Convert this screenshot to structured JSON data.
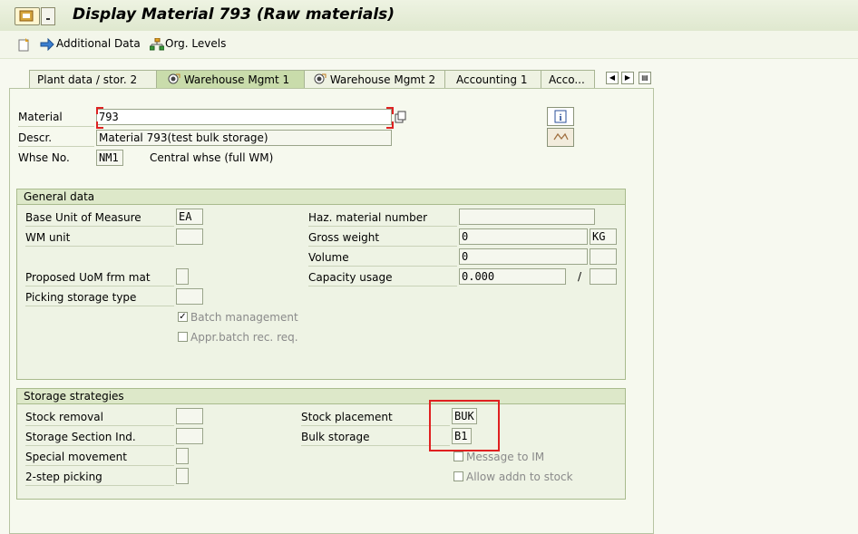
{
  "window": {
    "title": "Display Material 793 (Raw materials)"
  },
  "toolbar": {
    "additional_data": "Additional Data",
    "org_levels": "Org. Levels"
  },
  "tabs": [
    "Plant data / stor. 2",
    "Warehouse Mgmt 1",
    "Warehouse Mgmt 2",
    "Accounting 1",
    "Acco..."
  ],
  "header": {
    "material_label": "Material",
    "material_value": "793",
    "descr_label": "Descr.",
    "descr_value": "Material 793(test bulk storage)",
    "whse_label": "Whse No.",
    "whse_value": "NM1",
    "whse_text": "Central whse (full WM)"
  },
  "general": {
    "title": "General data",
    "base_uom_label": "Base Unit of Measure",
    "base_uom_value": "EA",
    "wm_unit_label": "WM unit",
    "wm_unit_value": "",
    "proposed_uom_label": "Proposed UoM frm mat",
    "proposed_uom_value": "",
    "picking_label": "Picking storage type",
    "picking_value": "",
    "batch_label": "Batch management",
    "batch_checked": true,
    "appr_label": "Appr.batch rec. req.",
    "appr_checked": false,
    "haz_label": "Haz. material number",
    "haz_value": "",
    "gross_label": "Gross weight",
    "gross_value": "0",
    "gross_unit": "KG",
    "volume_label": "Volume",
    "volume_value": "0",
    "volume_unit": "",
    "capacity_label": "Capacity usage",
    "capacity_value": "0.000",
    "capacity_sep": "/",
    "capacity_unit": ""
  },
  "strategies": {
    "title": "Storage strategies",
    "stock_removal_label": "Stock removal",
    "stock_removal_value": "",
    "section_ind_label": "Storage Section Ind.",
    "section_ind_value": "",
    "special_mvmt_label": "Special movement",
    "special_mvmt_value": "",
    "two_step_label": "2-step picking",
    "two_step_value": "",
    "placement_label": "Stock placement",
    "placement_value": "BUK",
    "bulk_label": "Bulk storage",
    "bulk_value": "B1",
    "msg_im_label": "Message to IM",
    "msg_im_checked": false,
    "allow_addn_label": "Allow addn to stock",
    "allow_addn_checked": false
  },
  "colors": {
    "highlight": "#e02020",
    "header_bg": "#dde8c9"
  }
}
